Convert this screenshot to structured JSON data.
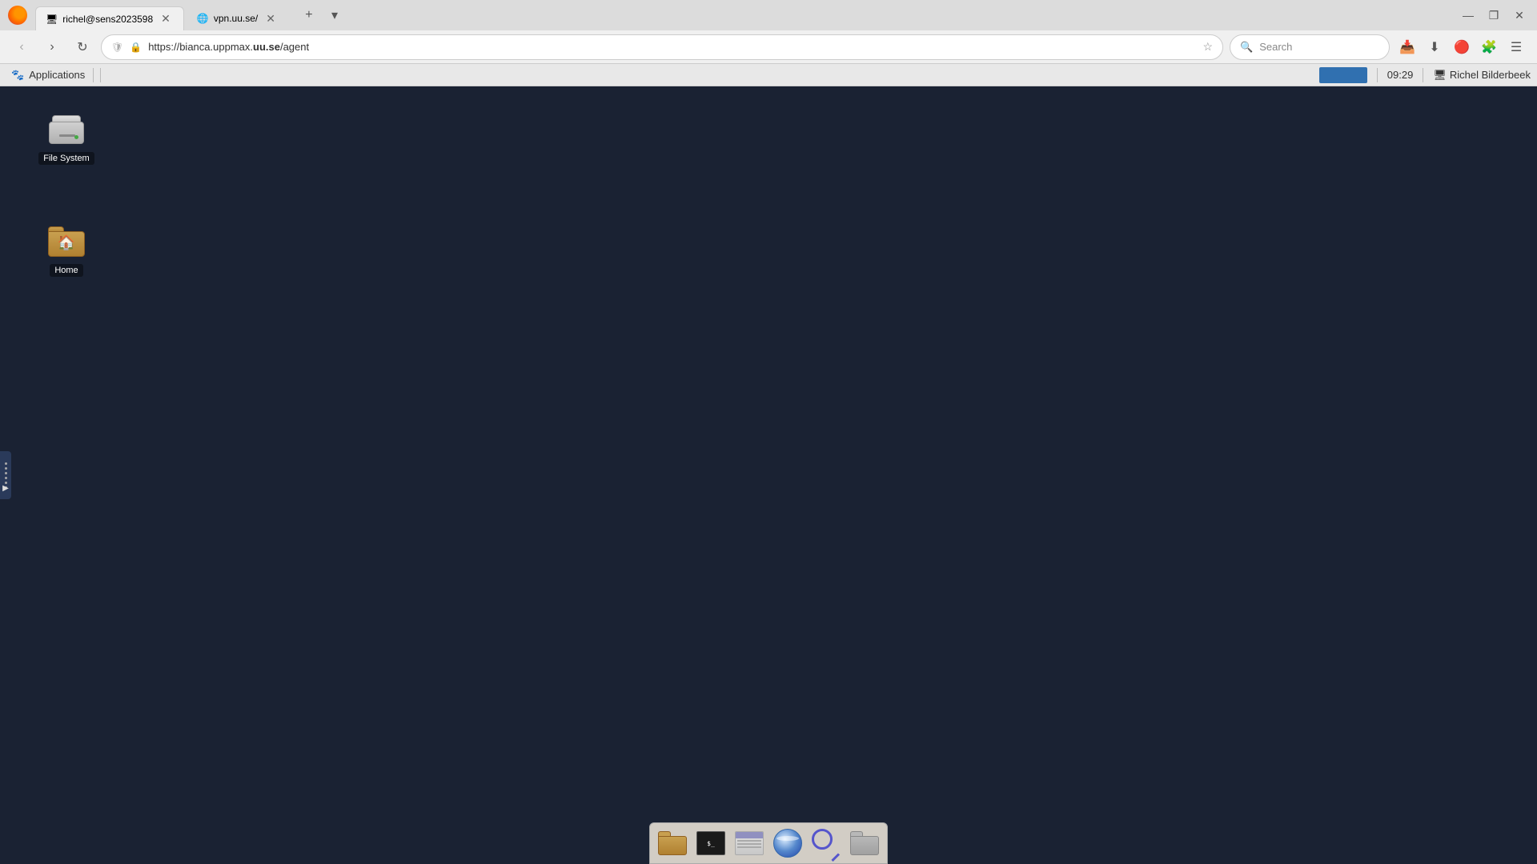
{
  "browser": {
    "tabs": [
      {
        "id": "tab1",
        "label": "richel@sens2023598",
        "active": true,
        "favicon": "terminal"
      },
      {
        "id": "tab2",
        "label": "vpn.uu.se/",
        "active": false,
        "favicon": "globe"
      }
    ],
    "new_tab_label": "+",
    "address": {
      "protocol_icon": "🔒",
      "url_before_bold": "https://bianca.uppmax.",
      "url_bold": "uu.se",
      "url_after": "/agent"
    },
    "search_placeholder": "Search",
    "window_controls": {
      "minimize": "—",
      "maximize": "❐",
      "close": "✕"
    }
  },
  "gnome_panel": {
    "applications_label": "Applications",
    "applet_icon": "🐾",
    "time": "09:29",
    "user_label": "Richel Bilderbeek",
    "user_icon": "🖥"
  },
  "desktop": {
    "icons": [
      {
        "id": "filesystem",
        "label": "File System",
        "type": "drive"
      },
      {
        "id": "home",
        "label": "Home",
        "type": "folder"
      }
    ]
  },
  "taskbar": {
    "icons": [
      {
        "id": "folder-home",
        "type": "folder-gold",
        "tooltip": "Home Folder"
      },
      {
        "id": "terminal",
        "type": "terminal",
        "tooltip": "Terminal"
      },
      {
        "id": "files",
        "type": "files",
        "tooltip": "File Manager"
      },
      {
        "id": "browser",
        "type": "globe",
        "tooltip": "Web Browser"
      },
      {
        "id": "search",
        "type": "search",
        "tooltip": "Search"
      },
      {
        "id": "folder-misc",
        "type": "folder-gray",
        "tooltip": "Folder"
      }
    ]
  },
  "side_panel": {
    "toggle_label": "▶"
  }
}
